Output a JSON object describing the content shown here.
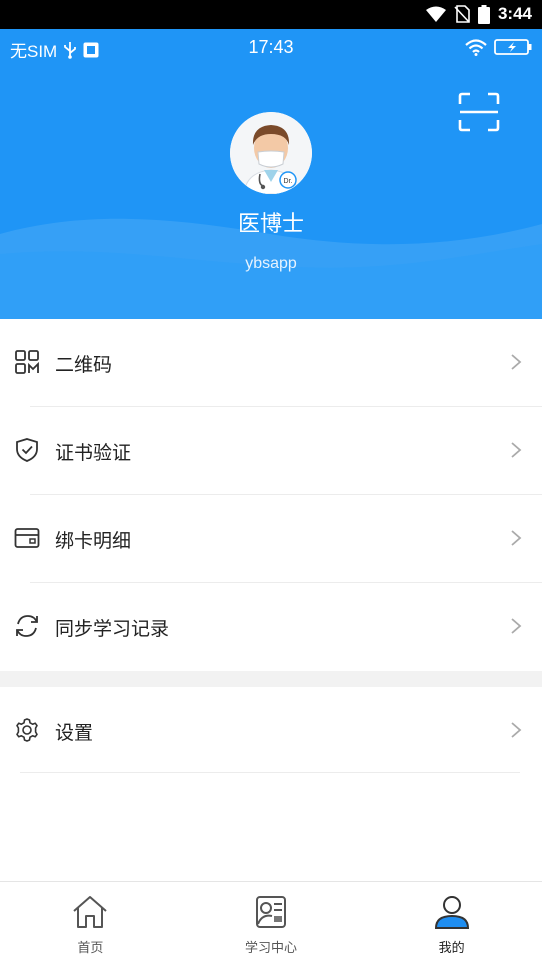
{
  "system_bar": {
    "time": "3:44"
  },
  "status_bar": {
    "carrier": "无SIM",
    "time": "17:43"
  },
  "profile": {
    "name": "医博士",
    "account": "ybsapp",
    "avatar_badge": "Dr."
  },
  "menu": [
    {
      "id": "qrcode",
      "label": "二维码",
      "icon": "qrcode-icon"
    },
    {
      "id": "cert",
      "label": "证书验证",
      "icon": "shield-check-icon"
    },
    {
      "id": "card",
      "label": "绑卡明细",
      "icon": "card-icon"
    },
    {
      "id": "sync",
      "label": "同步学习记录",
      "icon": "sync-icon"
    }
  ],
  "settings": {
    "label": "设置",
    "icon": "gear-icon"
  },
  "tabs": [
    {
      "id": "home",
      "label": "首页",
      "icon": "home-icon",
      "active": false
    },
    {
      "id": "study",
      "label": "学习中心",
      "icon": "study-center-icon",
      "active": false
    },
    {
      "id": "mine",
      "label": "我的",
      "icon": "user-icon",
      "active": true
    }
  ],
  "colors": {
    "header_blue": "#1f95f6",
    "active_tab": "#1f8ef1"
  }
}
